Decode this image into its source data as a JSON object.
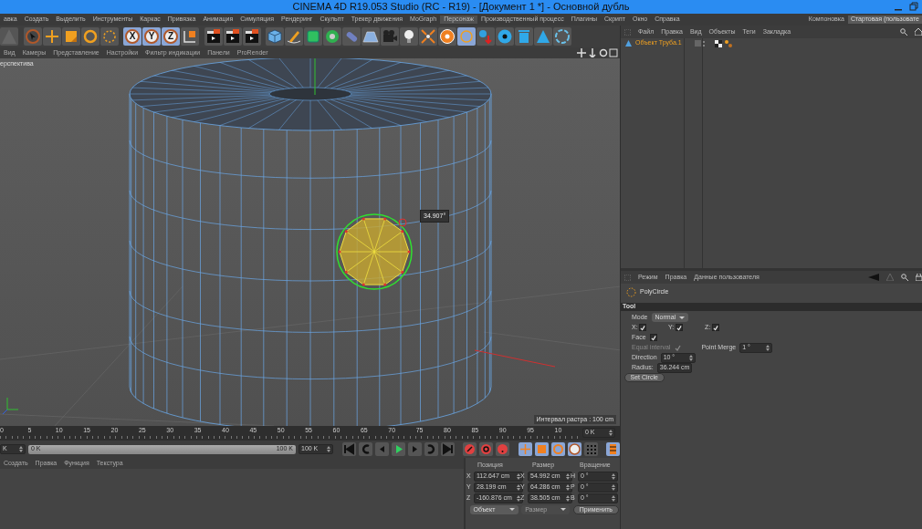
{
  "window": {
    "title": "CINEMA 4D R19.053 Studio (RC - R19) - [Документ 1 *] - Основной дубль"
  },
  "menu": [
    {
      "label": "авка",
      "selected": false
    },
    {
      "label": "Создать",
      "selected": false
    },
    {
      "label": "Выделить",
      "selected": false
    },
    {
      "label": "Инструменты",
      "selected": false
    },
    {
      "label": "Каркас",
      "selected": false
    },
    {
      "label": "Привязка",
      "selected": false
    },
    {
      "label": "Анимация",
      "selected": false
    },
    {
      "label": "Симуляция",
      "selected": false
    },
    {
      "label": "Рендеринг",
      "selected": false
    },
    {
      "label": "Скульпт",
      "selected": false
    },
    {
      "label": "Трекер движения",
      "selected": false
    },
    {
      "label": "MoGraph",
      "selected": false
    },
    {
      "label": "Персонаж",
      "selected": true
    },
    {
      "label": "Производственный процесс",
      "selected": false
    },
    {
      "label": "Плагины",
      "selected": false
    },
    {
      "label": "Скрипт",
      "selected": false
    },
    {
      "label": "Окно",
      "selected": false
    },
    {
      "label": "Справка",
      "selected": false
    }
  ],
  "layout": {
    "label": "Компоновка",
    "value": "Стартовая (пользовате"
  },
  "axis_buttons": [
    {
      "label": "X",
      "selected": true
    },
    {
      "label": "Y",
      "selected": true
    },
    {
      "label": "Z",
      "selected": true
    }
  ],
  "viewport": {
    "menu": [
      "Вид",
      "Камеры",
      "Представление",
      "Настройки",
      "Фильтр индикации",
      "Панели",
      "ProRender"
    ],
    "camera_label": "ерспектива",
    "angle_label": "34.907°",
    "grid_info": "Интервал растра : 100 cm"
  },
  "timeline": {
    "ticks": [
      "0",
      "5",
      "10",
      "15",
      "20",
      "25",
      "30",
      "35",
      "40",
      "45",
      "50",
      "55",
      "60",
      "65",
      "70",
      "75",
      "80",
      "85",
      "90",
      "95",
      "10"
    ],
    "current_field": "0 K",
    "start_field": "K",
    "range_start": "0 K",
    "level": 1,
    "range_end": "100 K",
    "end_field": "100 K"
  },
  "material_menu": [
    "Создать",
    "Правка",
    "Функция",
    "Текстура"
  ],
  "coordinates": {
    "headers": [
      "Позиция",
      "Размер",
      "Вращение"
    ],
    "rows": [
      {
        "axis": "X",
        "position": "112.647 cm",
        "size_axis": "X",
        "size": "54.992 cm",
        "rotation_axis": "H",
        "rotation": "0 °"
      },
      {
        "axis": "Y",
        "position": "28.199 cm",
        "size_axis": "Y",
        "size": "64.286 cm",
        "rotation_axis": "P",
        "rotation": "0 °"
      },
      {
        "axis": "Z",
        "position": "-160.876 cm",
        "size_axis": "Z",
        "size": "38.505 cm",
        "rotation_axis": "B",
        "rotation": "0 °"
      }
    ],
    "mode": {
      "value": "Объект"
    },
    "size_mode": {
      "value": "Размер",
      "disabled": true
    },
    "apply": "Применить"
  },
  "objects": {
    "menu": [
      "Файл",
      "Правка",
      "Вид",
      "Объекты",
      "Теги",
      "Закладка"
    ],
    "items": [
      {
        "name": "Объект Труба.1",
        "selected": true
      }
    ]
  },
  "attributes": {
    "menu": [
      "Режим",
      "Правка",
      "Данные пользователя"
    ],
    "tool_name": "PolyCircle",
    "section": "Tool",
    "mode": {
      "label": "Mode",
      "value": "Normal"
    },
    "axes": [
      {
        "label": "X:",
        "checked": true
      },
      {
        "label": "Y:",
        "checked": true
      },
      {
        "label": "Z:",
        "checked": true
      }
    ],
    "face": {
      "label": "Face",
      "checked": true
    },
    "equal_interval": {
      "label": "Equal interval",
      "checked": true,
      "disabled": true
    },
    "point_merge": {
      "label": "Point Merge",
      "value": "1 °"
    },
    "direction": {
      "label": "Direction",
      "value": "10 °"
    },
    "radius": {
      "label": "Radius:",
      "value": "36.244 cm"
    },
    "button": "Set Circle"
  }
}
